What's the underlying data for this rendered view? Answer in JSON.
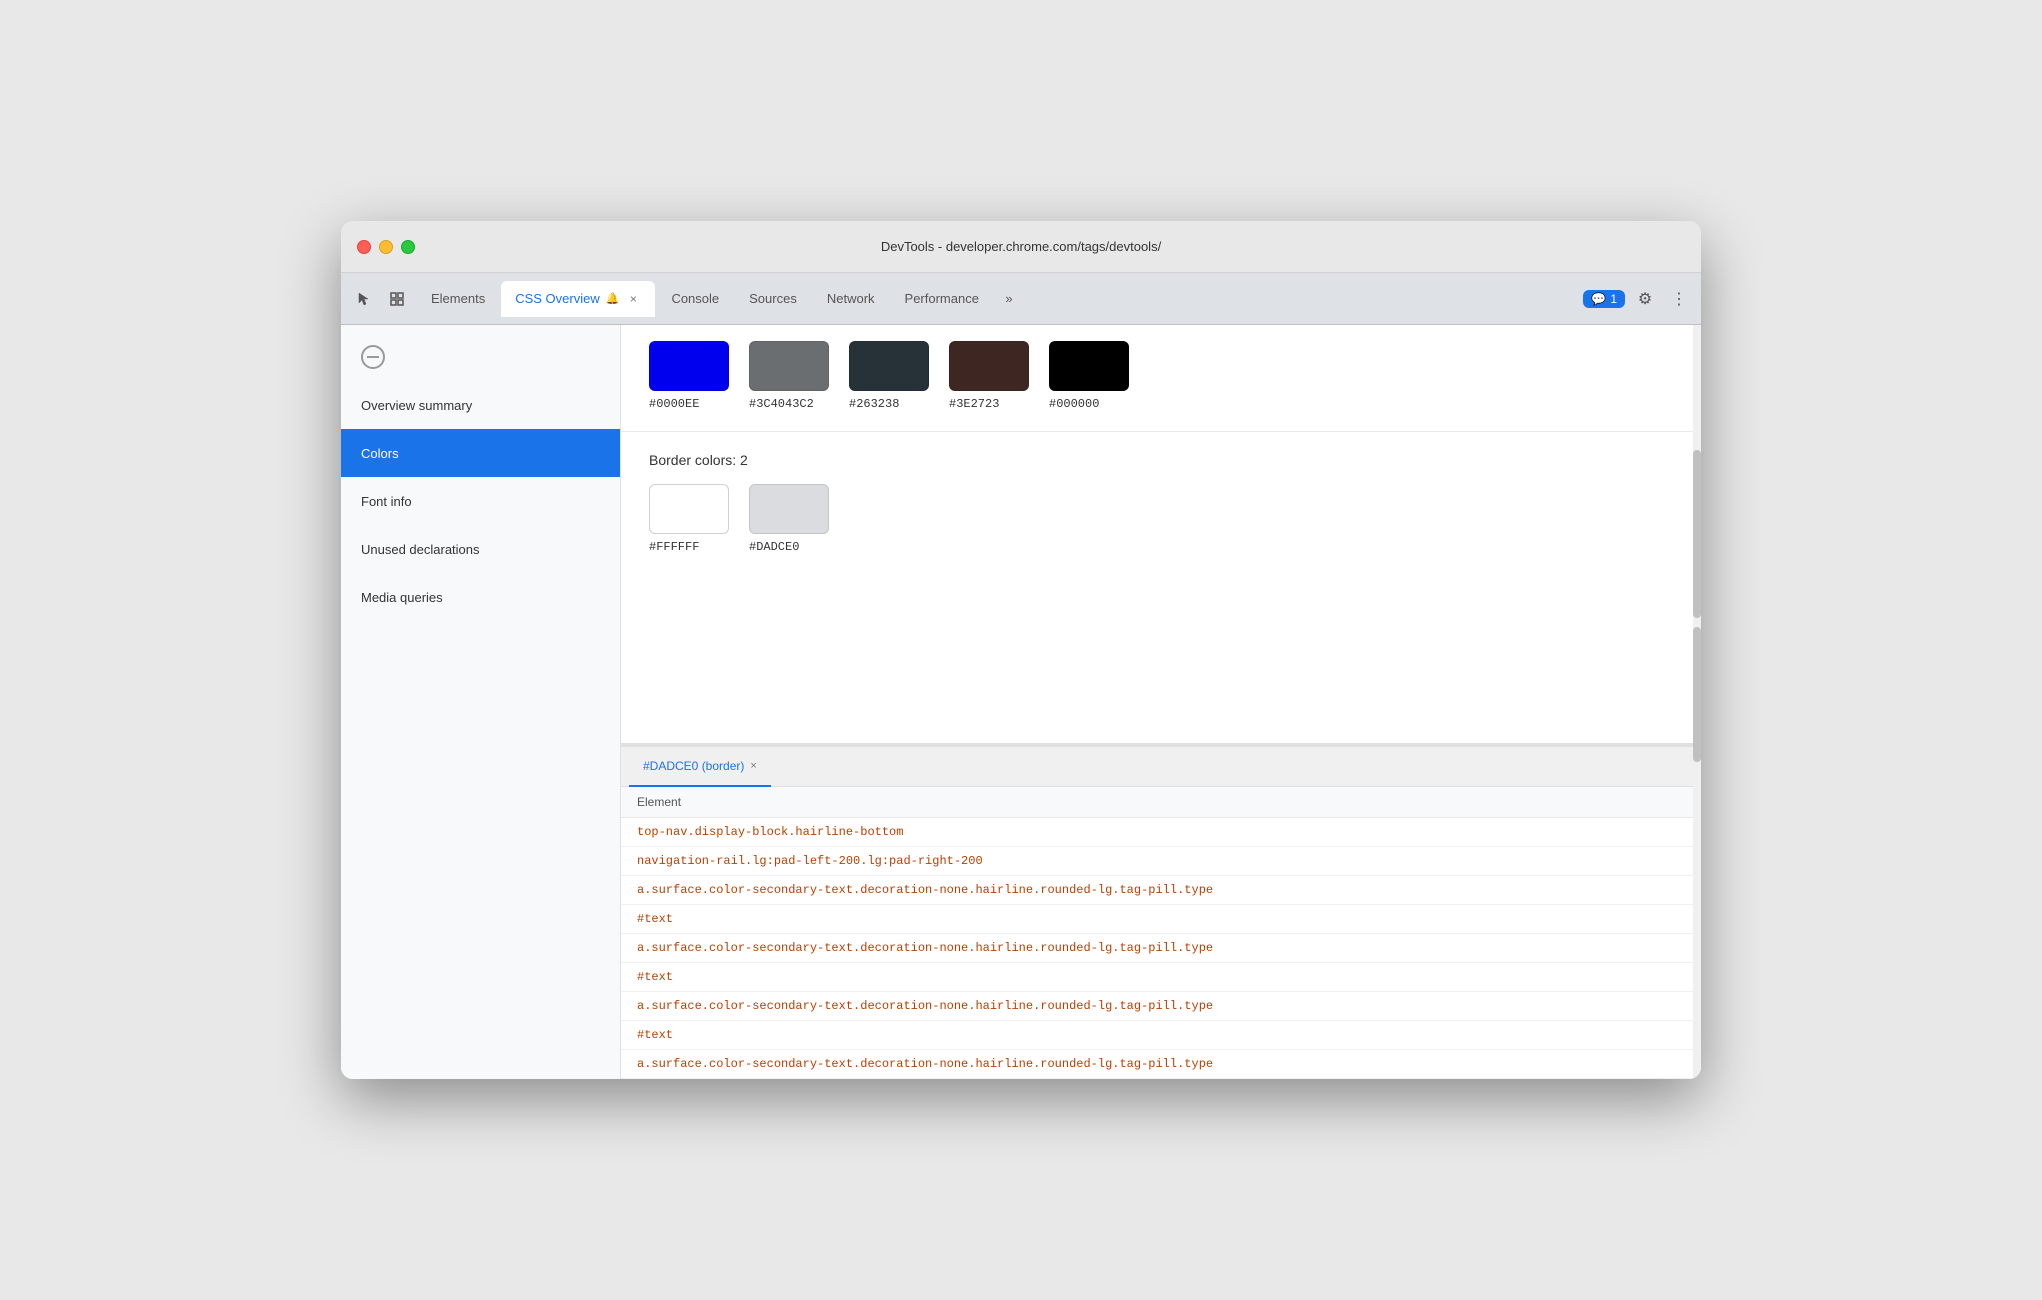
{
  "window": {
    "title": "DevTools - developer.chrome.com/tags/devtools/"
  },
  "tabbar": {
    "devtools_icon1": "⬚",
    "devtools_icon2": "⬒",
    "tabs": [
      {
        "id": "elements",
        "label": "Elements",
        "active": false,
        "closable": false
      },
      {
        "id": "css-overview",
        "label": "CSS Overview",
        "active": true,
        "closable": true,
        "has_bell": true
      },
      {
        "id": "console",
        "label": "Console",
        "active": false,
        "closable": false
      },
      {
        "id": "sources",
        "label": "Sources",
        "active": false,
        "closable": false
      },
      {
        "id": "network",
        "label": "Network",
        "active": false,
        "closable": false
      },
      {
        "id": "performance",
        "label": "Performance",
        "active": false,
        "closable": false
      }
    ],
    "more_label": "»",
    "message_count": "1",
    "gear_icon": "⚙",
    "dots_icon": "⋮"
  },
  "sidebar": {
    "items": [
      {
        "id": "overview-summary",
        "label": "Overview summary",
        "active": false
      },
      {
        "id": "colors",
        "label": "Colors",
        "active": true
      },
      {
        "id": "font-info",
        "label": "Font info",
        "active": false
      },
      {
        "id": "unused-declarations",
        "label": "Unused declarations",
        "active": false
      },
      {
        "id": "media-queries",
        "label": "Media queries",
        "active": false
      }
    ]
  },
  "content": {
    "top_swatches": [
      {
        "color": "#0000EE",
        "label": "#0000EE"
      },
      {
        "color": "#3C4043C2",
        "display_color": "rgba(60,64,67,0.76)",
        "label": "#3C4043C2"
      },
      {
        "color": "#263238",
        "label": "#263238"
      },
      {
        "color": "#3E2723",
        "label": "#3E2723"
      },
      {
        "color": "#000000",
        "label": "#000000"
      }
    ],
    "border_colors_heading": "Border colors: 2",
    "border_swatches": [
      {
        "color": "#FFFFFF",
        "label": "#FFFFFF"
      },
      {
        "color": "#DADCE0",
        "label": "#DADCE0"
      }
    ]
  },
  "bottom_panel": {
    "tab_label": "#DADCE0 (border)",
    "tab_close": "×",
    "table_header": "Element",
    "rows": [
      {
        "text": "top-nav.display-block.hairline-bottom",
        "type": "selector"
      },
      {
        "text": "navigation-rail.lg:pad-left-200.lg:pad-right-200",
        "type": "selector"
      },
      {
        "text": "a.surface.color-secondary-text.decoration-none.hairline.rounded-lg.tag-pill.type",
        "type": "selector"
      },
      {
        "text": "#text",
        "type": "text-node"
      },
      {
        "text": "a.surface.color-secondary-text.decoration-none.hairline.rounded-lg.tag-pill.type",
        "type": "selector"
      },
      {
        "text": "#text",
        "type": "text-node"
      },
      {
        "text": "a.surface.color-secondary-text.decoration-none.hairline.rounded-lg.tag-pill.type",
        "type": "selector"
      },
      {
        "text": "#text",
        "type": "text-node"
      },
      {
        "text": "a.surface.color-secondary-text.decoration-none.hairline.rounded-lg.tag-pill.type",
        "type": "selector"
      }
    ]
  },
  "colors": {
    "blue": "#0000EE",
    "dark_gray": "rgba(60,64,67,0.76)",
    "dark_blue": "#263238",
    "brown": "#3E2723",
    "black": "#000000",
    "white": "#FFFFFF",
    "light_gray": "#DADCE0"
  }
}
